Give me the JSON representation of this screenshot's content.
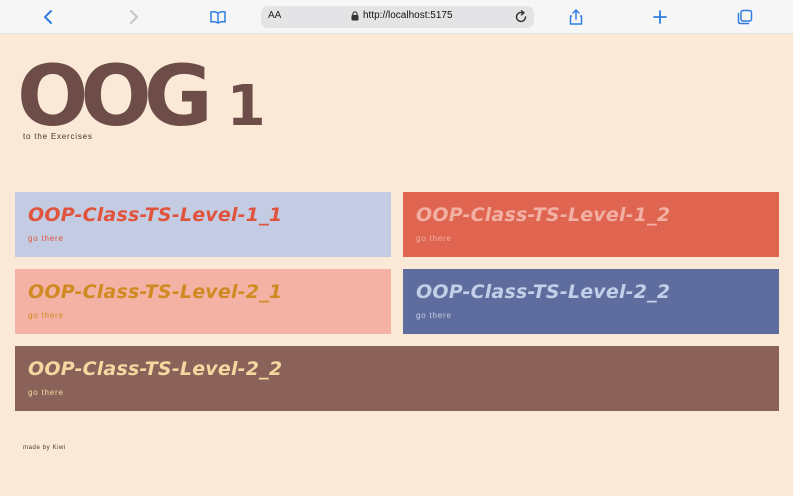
{
  "browser": {
    "text_size_label": "AA",
    "url": "http://localhost:5175",
    "icons": [
      "back-icon",
      "forward-icon",
      "bookmarks-icon",
      "lock-icon",
      "reload-icon",
      "share-icon",
      "new-tab-icon",
      "tabs-icon"
    ]
  },
  "header": {
    "title": "OOG",
    "title_number": "1",
    "subtitle": "to the Exercises"
  },
  "cards": [
    {
      "title": "OOP-Class-TS-Level-1_1",
      "link": "go there",
      "bg": "#c3cce2",
      "fg": "#e0533c"
    },
    {
      "title": "OOP-Class-TS-Level-1_2",
      "link": "go there",
      "bg": "#e06550",
      "fg": "#f2b0a4"
    },
    {
      "title": "OOP-Class-TS-Level-2_1",
      "link": "go there",
      "bg": "#f3b2a4",
      "fg": "#d08a22"
    },
    {
      "title": "OOP-Class-TS-Level-2_2",
      "link": "go there",
      "bg": "#5e6d9d",
      "fg": "#c3cfe8"
    },
    {
      "title": "OOP-Class-TS-Level-2_2",
      "link": "go there",
      "bg": "#8b6259",
      "fg": "#f5d7a0"
    }
  ],
  "footer": {
    "text": "made by Kiwi"
  },
  "colors": {
    "page_bg": "#fbe9d7",
    "brand": "#6e4d49",
    "toolbar_accent": "#2f7de1"
  }
}
